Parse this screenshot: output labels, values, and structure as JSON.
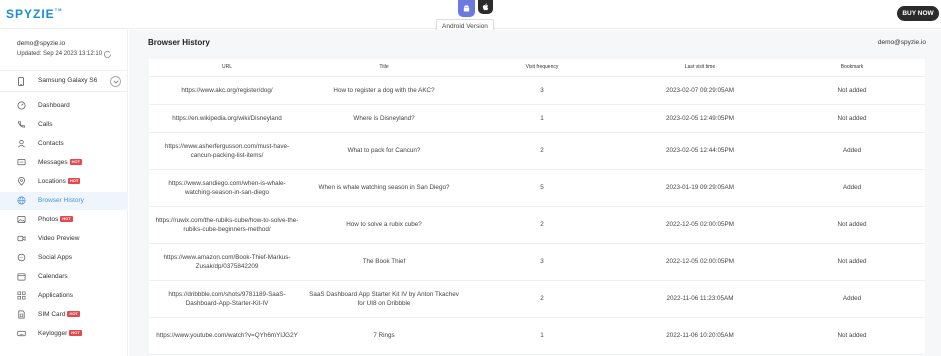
{
  "brand": {
    "name": "SPYZIE",
    "tm": "TM"
  },
  "top": {
    "tooltip": "Android Version",
    "buy_label": "BUY NOW"
  },
  "account": {
    "email": "demo@spyzie.io",
    "updated": "Updated: Sep 24 2023 13:12:10",
    "device": "Samsung Galaxy S6"
  },
  "nav": [
    {
      "label": "Dashboard",
      "icon": "dashboard-icon",
      "hot": ""
    },
    {
      "label": "Calls",
      "icon": "phone-icon",
      "hot": ""
    },
    {
      "label": "Contacts",
      "icon": "contacts-icon",
      "hot": ""
    },
    {
      "label": "Messages",
      "icon": "message-icon",
      "hot": "HOT"
    },
    {
      "label": "Locations",
      "icon": "location-icon",
      "hot": "HOT"
    },
    {
      "label": "Browser History",
      "icon": "globe-icon",
      "hot": ""
    },
    {
      "label": "Photos",
      "icon": "photo-icon",
      "hot": "HOT"
    },
    {
      "label": "Video Preview",
      "icon": "video-icon",
      "hot": ""
    },
    {
      "label": "Social Apps",
      "icon": "chat-icon",
      "hot": ""
    },
    {
      "label": "Calendars",
      "icon": "calendar-icon",
      "hot": ""
    },
    {
      "label": "Applications",
      "icon": "apps-icon",
      "hot": ""
    },
    {
      "label": "SIM Card",
      "icon": "sim-card-icon",
      "hot": "HOT"
    },
    {
      "label": "Keylogger",
      "icon": "keyboard-icon",
      "hot": "HOT"
    }
  ],
  "main": {
    "title": "Browser History",
    "email": "demo@spyzie.io",
    "columns": [
      "URL",
      "Title",
      "Visit frequency",
      "Last visit time",
      "Bookmark"
    ],
    "rows": [
      {
        "url": "https://www.akc.org/register/dog/",
        "title": "How to register a dog with the AKC?",
        "visits": "3",
        "time": "2023-02-07 09:29:05AM",
        "bookmark": "Not added"
      },
      {
        "url": "https://en.wikipedia.org/wiki/Disneyland",
        "title": "Where is Disneyland?",
        "visits": "1",
        "time": "2023-02-05 12:49:05PM",
        "bookmark": "Not added"
      },
      {
        "url": "https://www.asherfergusson.com/must-have-cancun-packing-list-items/",
        "title": "What to pack for Cancun?",
        "visits": "2",
        "time": "2023-02-05 12:44:05PM",
        "bookmark": "Added"
      },
      {
        "url": "https://www.sandiego.com/when-is-whale-watching-season-in-san-diego",
        "title": "When is whale watching season in San Diego?",
        "visits": "5",
        "time": "2023-01-19 09:29:05AM",
        "bookmark": "Added"
      },
      {
        "url": "https://ruwix.com/the-rubiks-cube/how-to-solve-the-rubiks-cube-beginners-method/",
        "title": "How to solve a rubix cube?",
        "visits": "2",
        "time": "2022-12-05 02:00:05PM",
        "bookmark": "Not added"
      },
      {
        "url": "https://www.amazon.com/Book-Thief-Markus-Zusak/dp/0375842209",
        "title": "The Book Thief",
        "visits": "3",
        "time": "2022-12-05 02:00:05PM",
        "bookmark": "Not added"
      },
      {
        "url": "https://dribbble.com/shots/9781189-SaaS-Dashboard-App-Starter-Kit-IV",
        "title": "SaaS Dashboard App Starter Kit IV by Anton Tkachev for UI8 on Dribbble",
        "visits": "2",
        "time": "2022-11-06 11:23:05AM",
        "bookmark": "Added"
      },
      {
        "url": "https://www.youtube.com/watch?v=QYh6mYIJG2Y",
        "title": "7 Rings",
        "visits": "1",
        "time": "2022-11-06 10:20:05AM",
        "bookmark": "Not added"
      }
    ]
  },
  "colors": {
    "brand": "#1a8cd8",
    "active_nav": "#4a90d9",
    "hot_badge": "#e5484d",
    "android_tab": "#6c7ae0",
    "buy_button": "#2b2b2b"
  }
}
